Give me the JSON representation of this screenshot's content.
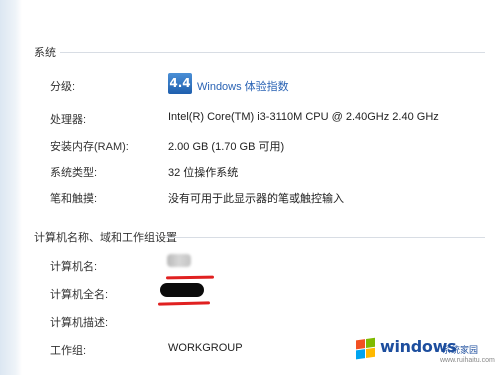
{
  "system": {
    "section_title": "系统",
    "rows": [
      {
        "label": "分级:",
        "value": ""
      },
      {
        "label": "处理器:",
        "value": "Intel(R) Core(TM) i3-3110M CPU @ 2.40GHz   2.40 GHz"
      },
      {
        "label": "安装内存(RAM):",
        "value": "2.00 GB (1.70 GB 可用)"
      },
      {
        "label": "系统类型:",
        "value": "32 位操作系统"
      },
      {
        "label": "笔和触摸:",
        "value": "没有可用于此显示器的笔或触控输入"
      }
    ],
    "rating": {
      "score": "4.4",
      "link_text": "Windows 体验指数"
    }
  },
  "computer": {
    "section_title": "计算机名称、域和工作组设置",
    "rows": [
      {
        "label": "计算机名:",
        "value": ""
      },
      {
        "label": "计算机全名:",
        "value": ""
      },
      {
        "label": "计算机描述:",
        "value": ""
      },
      {
        "label": "工作组:",
        "value": "WORKGROUP"
      }
    ]
  },
  "watermark": {
    "brand": "windows",
    "sub": "系统家园",
    "url": "www.ruihaitu.com"
  },
  "colors": {
    "link": "#2a63b4",
    "redaction_mark": "#e02020",
    "watermark": "#1d4e9e"
  }
}
